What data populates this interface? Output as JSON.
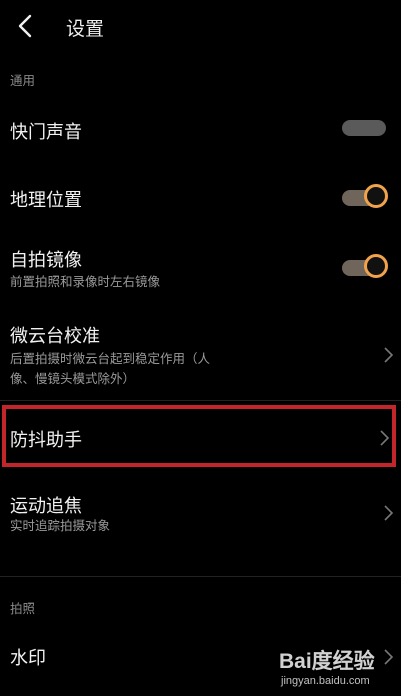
{
  "header": {
    "title": "设置"
  },
  "sections": [
    {
      "label": "通用"
    },
    {
      "label": "拍照"
    }
  ],
  "rows": [
    {
      "label": "快门声音",
      "toggle": "off"
    },
    {
      "label": "地理位置",
      "toggle": "on"
    },
    {
      "label": "自拍镜像",
      "subtitle": "前置拍照和录像时左右镜像",
      "toggle": "on"
    },
    {
      "label": "微云台校准",
      "subtitle_line1": "后置拍摄时微云台起到稳定作用（人",
      "subtitle_line2": "像、慢镜头模式除外）"
    },
    {
      "label": "防抖助手"
    },
    {
      "label": "运动追焦",
      "subtitle": "实时追踪拍摄对象"
    },
    {
      "label": "水印"
    }
  ],
  "colors": {
    "background": "#000000",
    "accent": "#f0a24c",
    "highlight": "#c2262a"
  },
  "watermark": {
    "brand": "Bai度经验",
    "url": "jingyan.baidu.com"
  }
}
